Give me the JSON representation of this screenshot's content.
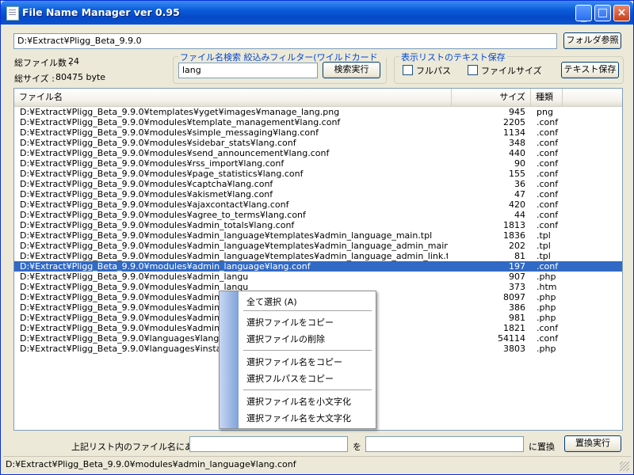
{
  "window": {
    "title": "File Name Manager ver 0.95"
  },
  "path": {
    "value": "D:¥Extract¥Pligg_Beta_9.9.0",
    "browse_label": "フォルダ参照"
  },
  "stats": {
    "file_count_label": "総ファイル数 :",
    "file_count": "24",
    "size_label": "総サイズ :",
    "size": "80475 byte"
  },
  "filter": {
    "legend": "ファイル名検索 絞込みフィルター(ワイルドカード可)",
    "value": "lang",
    "search_label": "検索実行"
  },
  "save": {
    "legend": "表示リストのテキスト保存",
    "fullpath_label": "フルパス",
    "filesize_label": "ファイルサイズ",
    "save_label": "テキスト保存"
  },
  "list": {
    "headers": {
      "name": "ファイル名",
      "size": "サイズ",
      "type": "種類"
    },
    "rows": [
      {
        "name": "D:¥Extract¥Pligg_Beta_9.9.0¥templates¥yget¥images¥manage_lang.png",
        "size": "945",
        "type": "png"
      },
      {
        "name": "D:¥Extract¥Pligg_Beta_9.9.0¥modules¥template_management¥lang.conf",
        "size": "2205",
        "type": ".conf"
      },
      {
        "name": "D:¥Extract¥Pligg_Beta_9.9.0¥modules¥simple_messaging¥lang.conf",
        "size": "1134",
        "type": ".conf"
      },
      {
        "name": "D:¥Extract¥Pligg_Beta_9.9.0¥modules¥sidebar_stats¥lang.conf",
        "size": "348",
        "type": ".conf"
      },
      {
        "name": "D:¥Extract¥Pligg_Beta_9.9.0¥modules¥send_announcement¥lang.conf",
        "size": "440",
        "type": ".conf"
      },
      {
        "name": "D:¥Extract¥Pligg_Beta_9.9.0¥modules¥rss_import¥lang.conf",
        "size": "90",
        "type": ".conf"
      },
      {
        "name": "D:¥Extract¥Pligg_Beta_9.9.0¥modules¥page_statistics¥lang.conf",
        "size": "155",
        "type": ".conf"
      },
      {
        "name": "D:¥Extract¥Pligg_Beta_9.9.0¥modules¥captcha¥lang.conf",
        "size": "36",
        "type": ".conf"
      },
      {
        "name": "D:¥Extract¥Pligg_Beta_9.9.0¥modules¥akismet¥lang.conf",
        "size": "47",
        "type": ".conf"
      },
      {
        "name": "D:¥Extract¥Pligg_Beta_9.9.0¥modules¥ajaxcontact¥lang.conf",
        "size": "420",
        "type": ".conf"
      },
      {
        "name": "D:¥Extract¥Pligg_Beta_9.9.0¥modules¥agree_to_terms¥lang.conf",
        "size": "44",
        "type": ".conf"
      },
      {
        "name": "D:¥Extract¥Pligg_Beta_9.9.0¥modules¥admin_totals¥lang.conf",
        "size": "1813",
        "type": ".conf"
      },
      {
        "name": "D:¥Extract¥Pligg_Beta_9.9.0¥modules¥admin_language¥templates¥admin_language_main.tpl",
        "size": "1836",
        "type": ".tpl"
      },
      {
        "name": "D:¥Extract¥Pligg_Beta_9.9.0¥modules¥admin_language¥templates¥admin_language_admin_main_link.tpl",
        "size": "202",
        "type": ".tpl"
      },
      {
        "name": "D:¥Extract¥Pligg_Beta_9.9.0¥modules¥admin_language¥templates¥admin_language_admin_link.tpl",
        "size": "81",
        "type": ".tpl"
      },
      {
        "name": "D:¥Extract¥Pligg_Beta_9.9.0¥modules¥admin_language¥lang.conf",
        "size": "197",
        "type": ".conf",
        "selected": true
      },
      {
        "name": "D:¥Extract¥Pligg_Beta_9.9.0¥modules¥admin_langu",
        "size": "907",
        "type": ".php"
      },
      {
        "name": "D:¥Extract¥Pligg_Beta_9.9.0¥modules¥admin_langu",
        "size": "373",
        "type": ".htm"
      },
      {
        "name": "D:¥Extract¥Pligg_Beta_9.9.0¥modules¥admin_langu",
        "size": "8097",
        "type": ".php"
      },
      {
        "name": "D:¥Extract¥Pligg_Beta_9.9.0¥modules¥admin_langu",
        "size": "386",
        "type": ".php"
      },
      {
        "name": "D:¥Extract¥Pligg_Beta_9.9.0¥modules¥admin_langu",
        "size": "981",
        "type": ".php"
      },
      {
        "name": "D:¥Extract¥Pligg_Beta_9.9.0¥modules¥admin_form",
        "size": "1821",
        "type": ".conf"
      },
      {
        "name": "D:¥Extract¥Pligg_Beta_9.9.0¥languages¥lang_engl",
        "size": "54114",
        "type": ".conf"
      },
      {
        "name": "D:¥Extract¥Pligg_Beta_9.9.0¥languages¥installer_l",
        "size": "3803",
        "type": ".php"
      }
    ]
  },
  "context_menu": {
    "select_all": "全て選択 (A)",
    "copy_files": "選択ファイルをコピー",
    "delete_files": "選択ファイルの削除",
    "copy_names": "選択ファイル名をコピー",
    "copy_fullpaths": "選択フルパスをコピー",
    "lowercase": "選択ファイル名を小文字化",
    "uppercase": "選択ファイル名を大文字化"
  },
  "replace": {
    "prefix": "上記リスト内のファイル名にある",
    "middle": "を",
    "suffix": "に置換",
    "button": "置換実行",
    "from_value": "",
    "to_value": ""
  },
  "status_bar": {
    "text": "D:¥Extract¥Pligg_Beta_9.9.0¥modules¥admin_language¥lang.conf"
  }
}
